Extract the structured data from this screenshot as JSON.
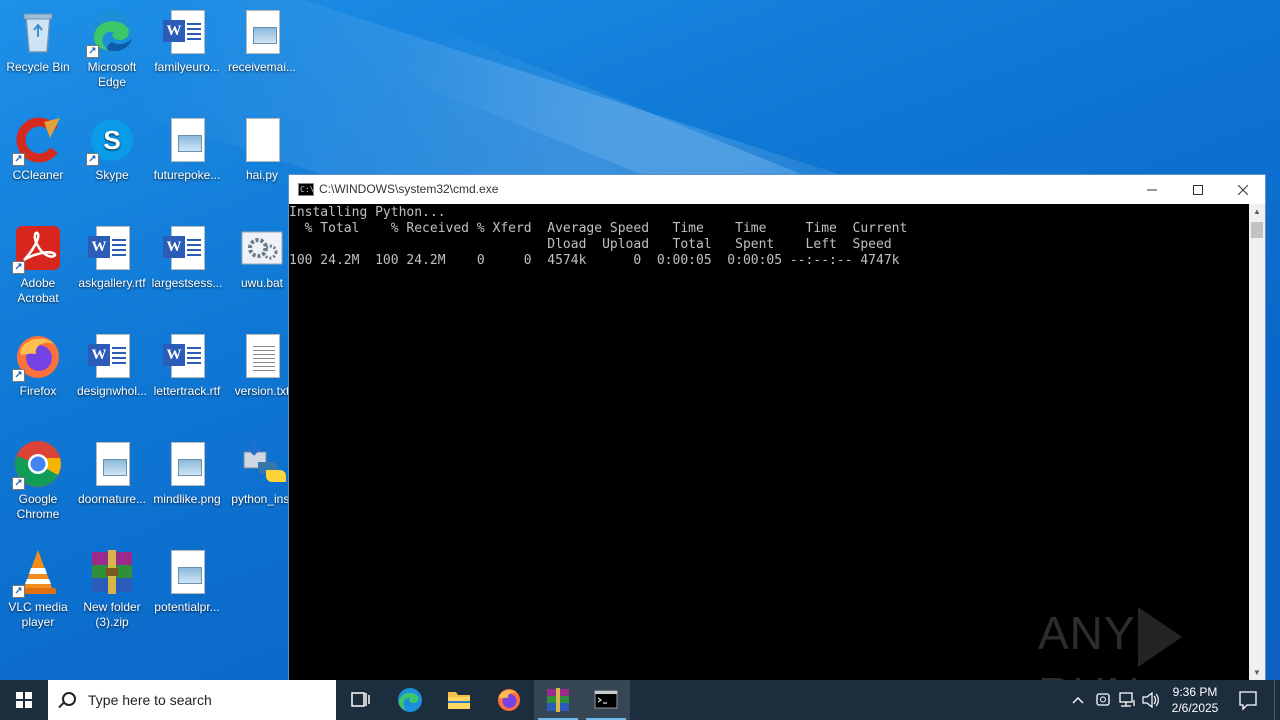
{
  "desktop": {
    "icons": [
      {
        "label": "Recycle Bin"
      },
      {
        "label": "Microsoft Edge"
      },
      {
        "label": "familyeuro..."
      },
      {
        "label": "receivemai..."
      },
      {
        "label": "CCleaner"
      },
      {
        "label": "Skype"
      },
      {
        "label": "futurepoke..."
      },
      {
        "label": "hai.py"
      },
      {
        "label": "Adobe Acrobat"
      },
      {
        "label": "askgallery.rtf"
      },
      {
        "label": "largestsess..."
      },
      {
        "label": "uwu.bat"
      },
      {
        "label": "Firefox"
      },
      {
        "label": "designwhol..."
      },
      {
        "label": "lettertrack.rtf"
      },
      {
        "label": "version.txt"
      },
      {
        "label": "Google Chrome"
      },
      {
        "label": "doornature..."
      },
      {
        "label": "mindlike.png"
      },
      {
        "label": "python_inst"
      },
      {
        "label": "VLC media player"
      },
      {
        "label": "New folder (3).zip"
      },
      {
        "label": "potentialpr..."
      }
    ]
  },
  "cmd": {
    "title": "C:\\WINDOWS\\system32\\cmd.exe",
    "output": "Installing Python...\n  % Total    % Received % Xferd  Average Speed   Time    Time     Time  Current\n                                 Dload  Upload   Total   Spent    Left  Speed\n100 24.2M  100 24.2M    0     0  4574k      0  0:00:05  0:00:05 --:--:-- 4747k"
  },
  "watermark": {
    "left": "ANY",
    "right": "RUN"
  },
  "taskbar": {
    "search_placeholder": "Type here to search",
    "time": "9:36 PM",
    "date": "2/6/2025"
  },
  "colors": {
    "desktop_bg": "#0f78d4",
    "taskbar_bg": "#1c2d3e",
    "console_bg": "#000000",
    "console_fg": "#c0c0c0"
  }
}
